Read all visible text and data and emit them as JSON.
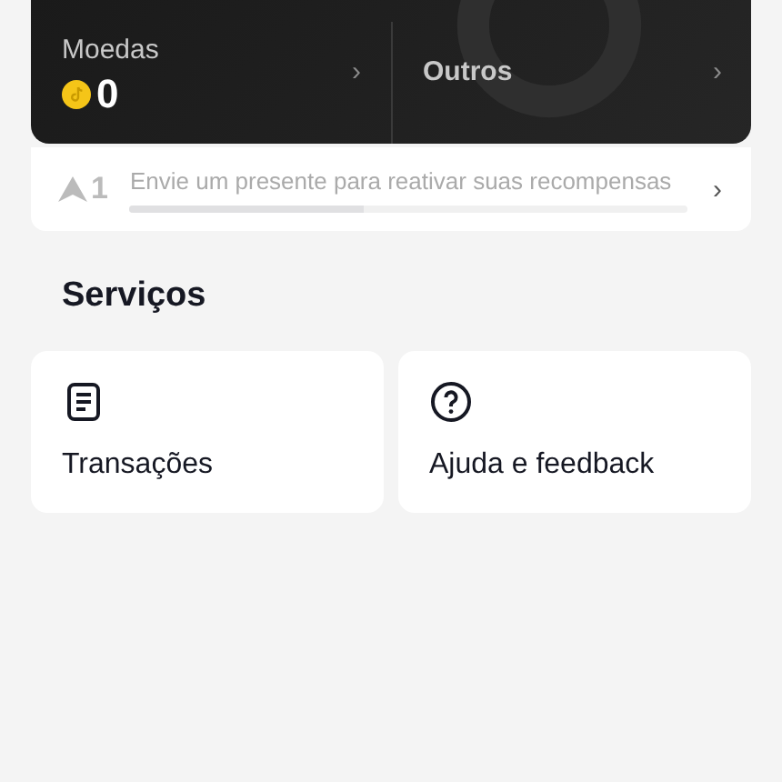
{
  "wallet": {
    "coins": {
      "label": "Moedas",
      "value": "0",
      "arrow": "›"
    },
    "others": {
      "label": "Outros",
      "arrow": "›"
    }
  },
  "rewards": {
    "level": "1",
    "message": "Envie um presente para reativar suas recompensas",
    "progress": {
      "level": 0.42
    },
    "arrow": "›"
  },
  "services": {
    "title": "Serviços",
    "items": [
      {
        "kind": "transactions",
        "label": "Transações"
      },
      {
        "kind": "help",
        "label": "Ajuda e feedback"
      }
    ]
  }
}
